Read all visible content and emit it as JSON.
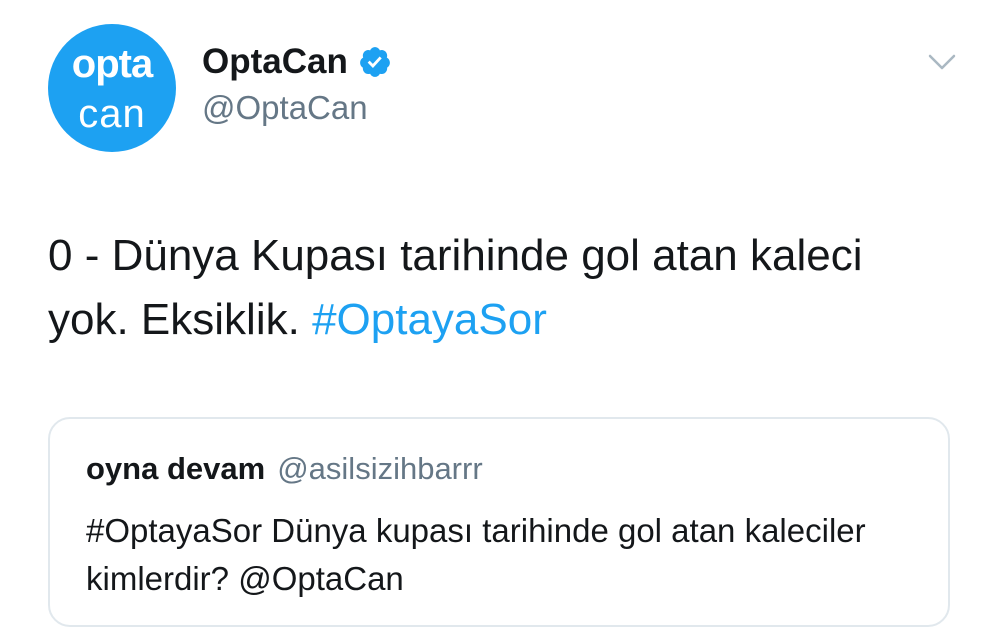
{
  "tweet": {
    "avatar": {
      "line1": "opta",
      "line2": "can"
    },
    "display_name": "OptaCan",
    "handle": "@OptaCan",
    "text_plain": "0 - Dünya Kupası tarihinde gol atan kaleci yok. Eksiklik.",
    "text_hashtag": "#OptayaSor",
    "colors": {
      "accent": "#1da1f2",
      "text": "#14171a",
      "muted": "#657786",
      "border": "#e1e8ed"
    }
  },
  "quote": {
    "display_name": "oyna devam",
    "handle": "@asilsizihbarrr",
    "text": "#OptayaSor Dünya kupası tarihinde gol atan kaleciler kimlerdir? @OptaCan"
  },
  "icons": {
    "verified": "verified-badge-icon",
    "menu": "chevron-down-icon"
  }
}
